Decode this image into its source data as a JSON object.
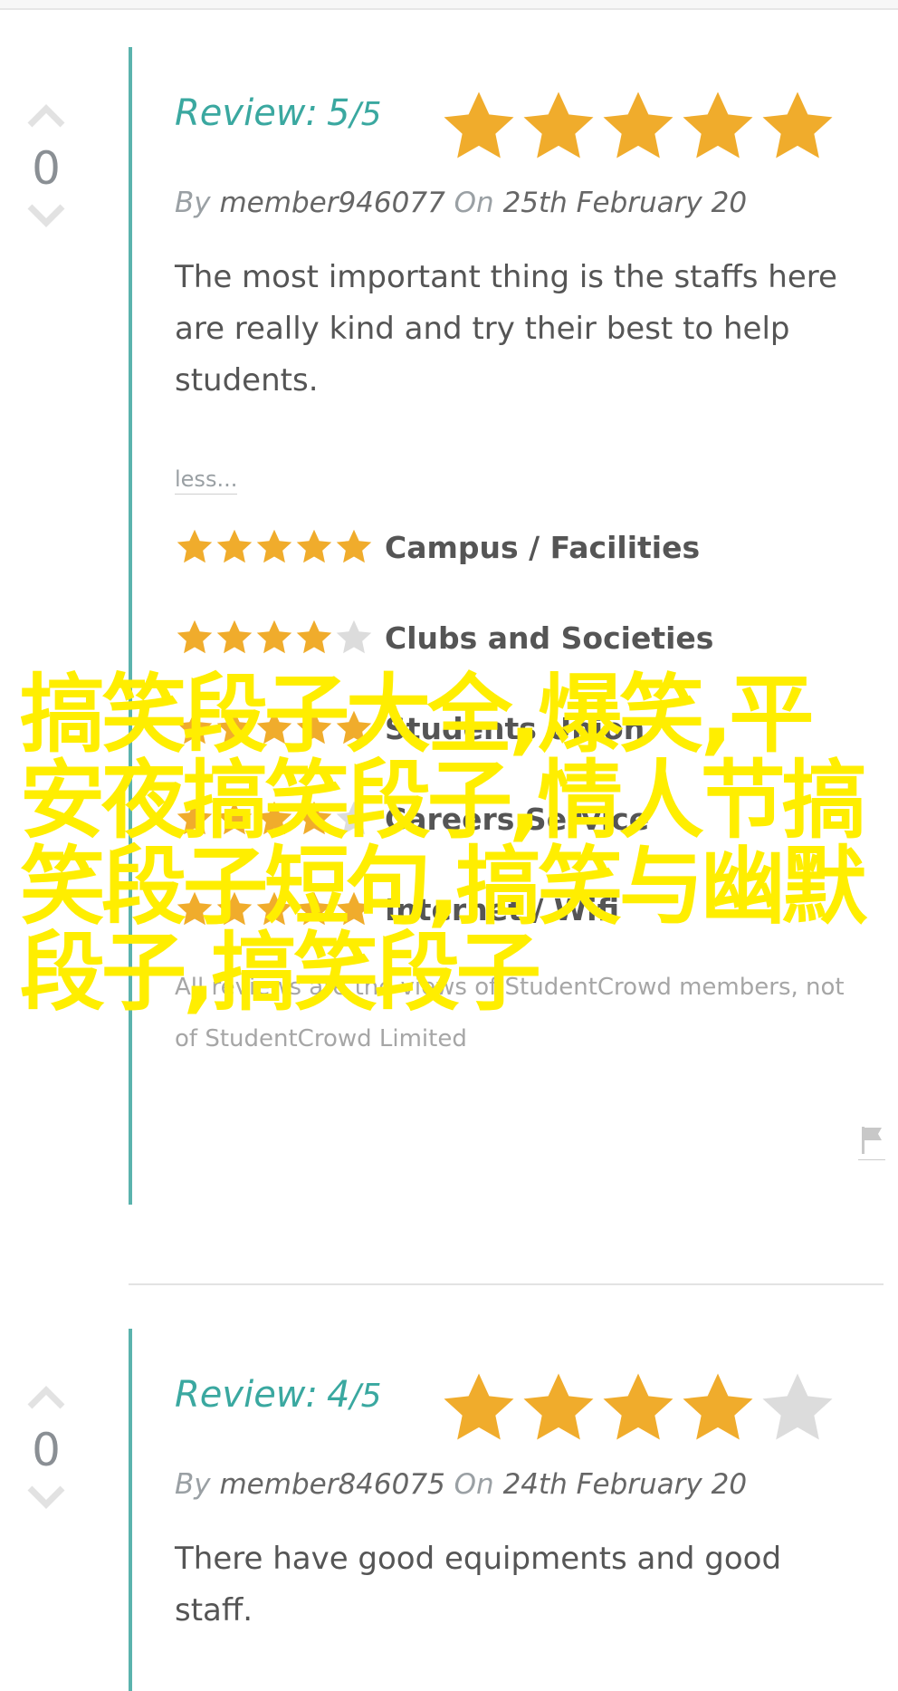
{
  "reviews": [
    {
      "votes": "0",
      "label": "Review:",
      "score": "5",
      "out_of": "/5",
      "stars": 5,
      "by": "By",
      "member": "member946077",
      "on": "On",
      "date": "25th February 20",
      "text": "The most important thing is the staffs here are really kind and try their best to help students.",
      "less": "less...",
      "categories": [
        {
          "label": "Campus / Facilities",
          "stars": 5
        },
        {
          "label": "Clubs and Societies",
          "stars": 4
        },
        {
          "label": "Students Union",
          "stars": 5
        },
        {
          "label": "Careers Service",
          "stars": 4
        },
        {
          "label": "Internet / Wifi",
          "stars": 5
        }
      ],
      "disclaimer": "All reviews are the views of StudentCrowd members, not of StudentCrowd Limited"
    },
    {
      "votes": "0",
      "label": "Review:",
      "score": "4",
      "out_of": "/5",
      "stars": 4,
      "by": "By",
      "member": "member846075",
      "on": "On",
      "date": "24th February 20",
      "text": "There have good equipments and good staff."
    }
  ],
  "overlay_text": "搞笑段子大全,爆笑,平安夜搞笑段子,情人节搞笑段子短句,搞笑与幽默段子,搞笑段子",
  "colors": {
    "accent": "#3aa8a0",
    "bar": "#5bb3ad",
    "star_on": "#f0ac2c",
    "star_off": "#dcdcdc",
    "overlay": "#ffee00"
  },
  "icons": [
    "upvote-icon",
    "downvote-icon",
    "star-icon",
    "flag-icon"
  ]
}
